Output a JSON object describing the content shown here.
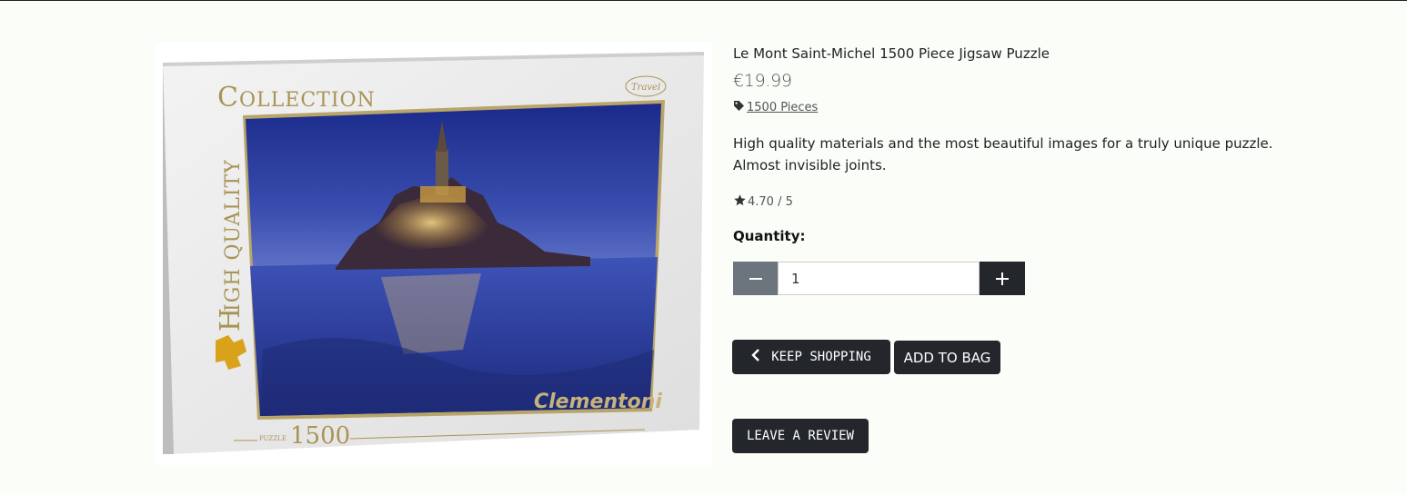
{
  "product": {
    "name": "Le Mont Saint-Michel 1500 Piece Jigsaw Puzzle",
    "price": "€19.99",
    "category": {
      "icon": "tag-icon",
      "label": "1500 Pieces"
    },
    "description": "High quality materials and the most beautiful images for a truly unique puzzle. Almost invisible joints.",
    "rating": {
      "icon": "star-icon",
      "value": "4.70 / 5"
    },
    "image": {
      "box_header": "COLLECTION",
      "box_side": "HIGH QUALITY",
      "box_brand": "Clementoni",
      "box_badge": "Travel",
      "box_puzzle_label": "PUZZLE",
      "box_piece_count": "1500"
    }
  },
  "quantity": {
    "label": "Quantity:",
    "value": "1",
    "decrement_icon": "minus-icon",
    "increment_icon": "plus-icon"
  },
  "actions": {
    "keep_shopping": "KEEP SHOPPING",
    "keep_shopping_icon": "chevron-left-icon",
    "add_to_bag": "ADD TO BAG",
    "leave_review": "LEAVE A REVIEW"
  },
  "colors": {
    "page_background": "#fbfdf9",
    "dark_button": "#23272b",
    "secondary_button": "#6c757d"
  }
}
